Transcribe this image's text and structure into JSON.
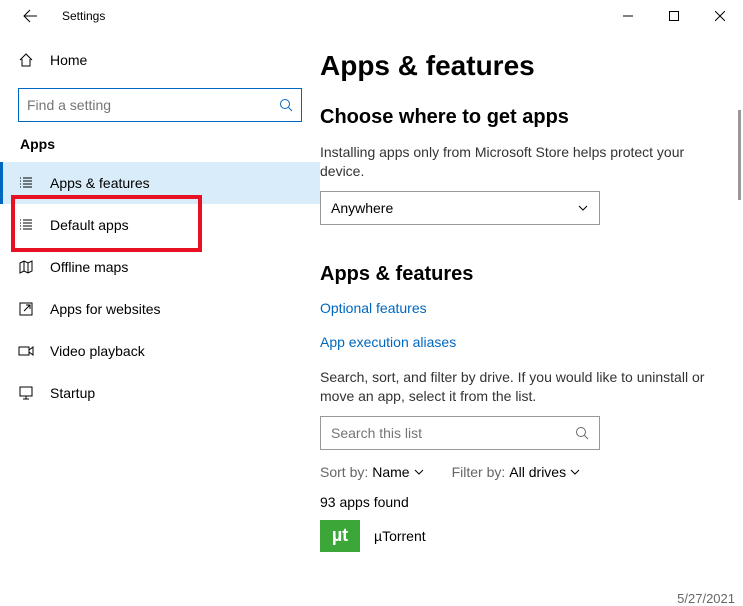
{
  "window": {
    "title": "Settings"
  },
  "sidebar": {
    "home": "Home",
    "searchPlaceholder": "Find a setting",
    "category": "Apps",
    "items": [
      {
        "label": "Apps & features"
      },
      {
        "label": "Default apps"
      },
      {
        "label": "Offline maps"
      },
      {
        "label": "Apps for websites"
      },
      {
        "label": "Video playback"
      },
      {
        "label": "Startup"
      }
    ]
  },
  "main": {
    "title": "Apps & features",
    "sourceHeading": "Choose where to get apps",
    "sourceDesc": "Installing apps only from Microsoft Store helps protect your device.",
    "sourceValue": "Anywhere",
    "featuresHeading": "Apps & features",
    "optionalLink": "Optional features",
    "aliasesLink": "App execution aliases",
    "filterDesc": "Search, sort, and filter by drive. If you would like to uninstall or move an app, select it from the list.",
    "listPlaceholder": "Search this list",
    "sortLabel": "Sort by:",
    "sortValue": "Name",
    "filterLabel": "Filter by:",
    "filterValue": "All drives",
    "countText": "93 apps found",
    "firstApp": "µTorrent",
    "firstAppIconText": "µt",
    "date": "5/27/2021"
  }
}
